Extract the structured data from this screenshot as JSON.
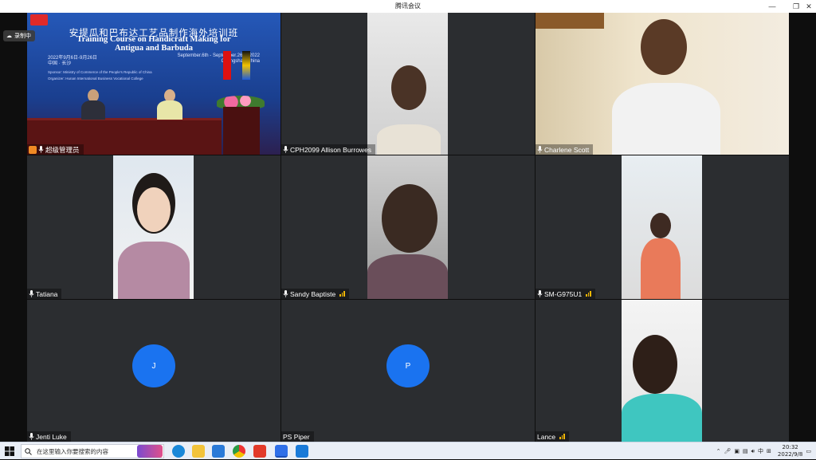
{
  "window": {
    "title": "腾讯会议"
  },
  "recording": {
    "label": "录制中"
  },
  "banner": {
    "title_cn": "安提瓜和巴布达工艺品制作海外培训班",
    "title_en_line1": "Training Course on Handicraft Making for",
    "title_en_line2": "Antigua and Barbuda",
    "date_cn": "2022年9月6日-9月26日",
    "date_en": "September.6th - September.26th, 2022",
    "location_cn": "中国 · 长沙",
    "location_en": "Changsha · China",
    "sponsor": "Sponsor: Ministry of Commerce of the People's Republic of China",
    "organizer": "Organizer: Hunan International Business Vocational College"
  },
  "participants": [
    {
      "name": "超级管理员",
      "kind": "video",
      "host": true
    },
    {
      "name": "CPH2099 Allison Burrowes",
      "kind": "video"
    },
    {
      "name": "Charlene Scott",
      "kind": "video"
    },
    {
      "name": "Tatiana",
      "kind": "video"
    },
    {
      "name": "Sandy Baptiste",
      "kind": "video",
      "signal": true
    },
    {
      "name": "SM-G975U1",
      "kind": "video",
      "signal": true
    },
    {
      "name": "Jenti Luke",
      "kind": "avatar",
      "initial": "J"
    },
    {
      "name": "PS Piper",
      "kind": "avatar",
      "initial": "P"
    },
    {
      "name": "Lance",
      "kind": "video",
      "signal": true
    }
  ],
  "taskbar": {
    "search_placeholder": "在这里输入你要搜索的内容",
    "time": "20:32",
    "date": "2022/9/8",
    "ime": "中"
  },
  "colors": {
    "avatar_blue": "#1a73f0",
    "signal_yellow": "#f2b705",
    "tile_bg": "#2b2d30"
  }
}
